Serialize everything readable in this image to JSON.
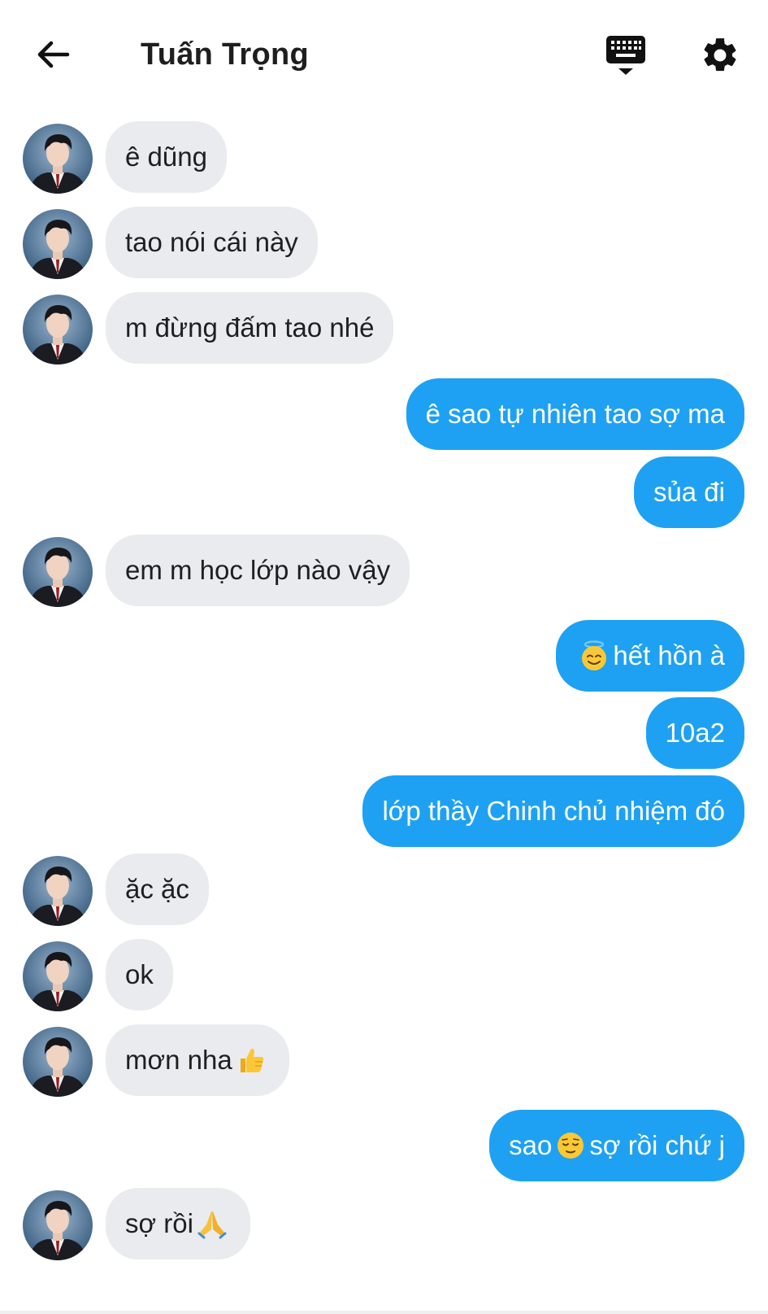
{
  "header": {
    "title": "Tuấn Trọng",
    "back_icon": "arrow-left-icon",
    "keyboard_icon": "keyboard-hide-icon",
    "settings_icon": "gear-icon"
  },
  "colors": {
    "incoming_bubble": "#e9ebef",
    "outgoing_bubble": "#1ea1f2",
    "title": "#1e1e1e"
  },
  "messages": [
    {
      "side": "in",
      "text": "ê dũng"
    },
    {
      "side": "in",
      "text": "tao nói cái này"
    },
    {
      "side": "in",
      "text": "m đừng đấm tao nhé"
    },
    {
      "side": "out",
      "text": "ê sao tự nhiên tao sợ ma"
    },
    {
      "side": "out",
      "text": "sủa đi"
    },
    {
      "side": "in",
      "text": "em m học lớp nào vậy"
    },
    {
      "side": "out",
      "text": "hết hồn à",
      "emoji": "smiling-face-with-halo"
    },
    {
      "side": "out",
      "text": "10a2"
    },
    {
      "side": "out",
      "text": "lớp thầy Chinh chủ nhiệm đó"
    },
    {
      "side": "in",
      "text": "ặc ặc"
    },
    {
      "side": "in",
      "text": "ok"
    },
    {
      "side": "in",
      "text_before": "mơn nha",
      "emoji": "thumbs-up"
    },
    {
      "side": "out",
      "text_before": "sao",
      "emoji": "relieved-face",
      "text_after": "sợ rồi chứ j"
    },
    {
      "side": "in",
      "text_before": "sợ rồi",
      "emoji": "folded-hands"
    }
  ]
}
